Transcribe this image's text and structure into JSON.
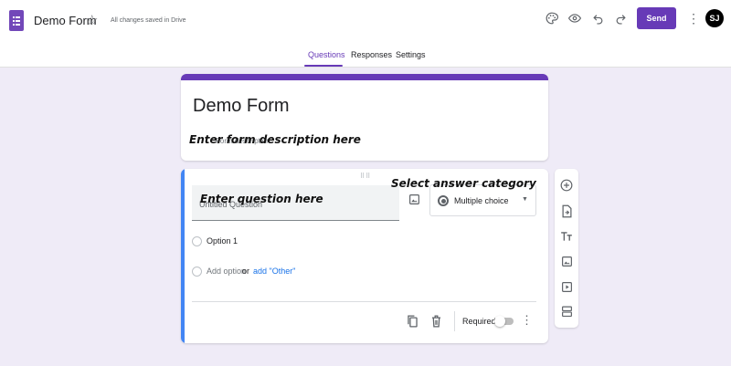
{
  "app": {
    "doc_title": "Demo Form",
    "save_status": "All changes saved in Drive",
    "send_label": "Send",
    "avatar_initials": "SJ",
    "accent_color": "#673ab7",
    "icons": [
      "forms-app-icon",
      "star-icon",
      "palette-icon",
      "preview-eye-icon",
      "undo-icon",
      "redo-icon",
      "more-vert-icon"
    ]
  },
  "tabs": [
    {
      "label": "Questions",
      "active": true
    },
    {
      "label": "Responses",
      "active": false
    },
    {
      "label": "Settings",
      "active": false
    }
  ],
  "form": {
    "title": "Demo Form",
    "description_placeholder": "Form description"
  },
  "question": {
    "placeholder": "Untitled Question",
    "type": "Multiple choice",
    "options": [
      "Option 1"
    ],
    "add_option": "Add option",
    "or": "or",
    "add_other": "add \"Other\"",
    "required_label": "Required",
    "required": false
  },
  "annotations": {
    "description": "Enter form description here",
    "question": "Enter question here",
    "category": "Select answer category"
  },
  "side_toolbar": [
    "add-question-icon",
    "import-questions-icon",
    "add-title-text-icon",
    "add-image-icon",
    "add-video-icon",
    "add-section-icon"
  ]
}
